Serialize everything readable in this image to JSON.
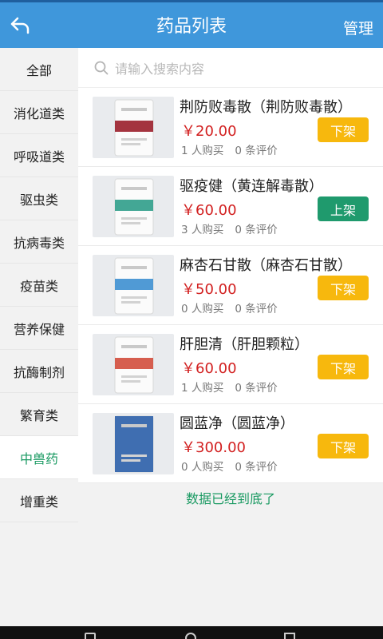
{
  "header": {
    "title": "药品列表",
    "right_label": "管理"
  },
  "sidebar": {
    "items": [
      {
        "label": "全部"
      },
      {
        "label": "消化道类"
      },
      {
        "label": "呼吸道类"
      },
      {
        "label": "驱虫类"
      },
      {
        "label": "抗病毒类"
      },
      {
        "label": "疫苗类"
      },
      {
        "label": "营养保健"
      },
      {
        "label": "抗酶制剂"
      },
      {
        "label": "繁育类"
      },
      {
        "label": "中兽药"
      },
      {
        "label": "增重类"
      }
    ],
    "active_index": 9
  },
  "search": {
    "placeholder": "请输入搜索内容"
  },
  "products": [
    {
      "name": "荆防败毒散（荆防败毒散）",
      "price": "￥20.00",
      "buyers": "1 人购买",
      "reviews": "0 条评价",
      "action": "下架",
      "action_color": "#f7b80d",
      "pack_color": "#9a1e2a"
    },
    {
      "name": "驱疫健（黄连解毒散）",
      "price": "￥60.00",
      "buyers": "3 人购买",
      "reviews": "0 条评价",
      "action": "上架",
      "action_color": "#1f9a6d",
      "pack_color": "#2f9d8a"
    },
    {
      "name": "麻杏石甘散（麻杏石甘散）",
      "price": "￥50.00",
      "buyers": "0 人购买",
      "reviews": "0 条评价",
      "action": "下架",
      "action_color": "#f7b80d",
      "pack_color": "#3d8fd0"
    },
    {
      "name": "肝胆清（肝胆颗粒）",
      "price": "￥60.00",
      "buyers": "1 人购买",
      "reviews": "0 条评价",
      "action": "下架",
      "action_color": "#f7b80d",
      "pack_color": "#d24c3c"
    },
    {
      "name": "圆蓝净（圆蓝净）",
      "price": "￥300.00",
      "buyers": "0 人购买",
      "reviews": "0 条评价",
      "action": "下架",
      "action_color": "#f7b80d",
      "pack_color": "#2a5ea8"
    }
  ],
  "list_end_text": "数据已经到底了",
  "icons": {
    "back": "back-arrow-icon",
    "search": "search-icon"
  }
}
